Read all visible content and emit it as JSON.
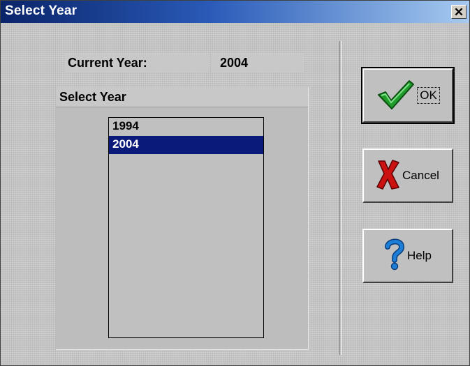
{
  "window": {
    "title": "Select Year",
    "close_glyph": "✕"
  },
  "current": {
    "label": "Current Year:",
    "value": "2004"
  },
  "group": {
    "title": "Select Year"
  },
  "years": [
    {
      "label": "1994",
      "selected": false
    },
    {
      "label": "2004",
      "selected": true
    }
  ],
  "buttons": {
    "ok": {
      "label": "OK",
      "icon": "checkmark-icon"
    },
    "cancel": {
      "label": "Cancel",
      "icon": "red-x-icon"
    },
    "help": {
      "label": "Help",
      "icon": "question-mark-icon"
    }
  },
  "colors": {
    "titlebar": "#0a246a",
    "selection": "#0a1a7a",
    "check_green": "#1f9c2a",
    "cancel_red": "#cc1111",
    "help_blue": "#1c7ed6"
  }
}
